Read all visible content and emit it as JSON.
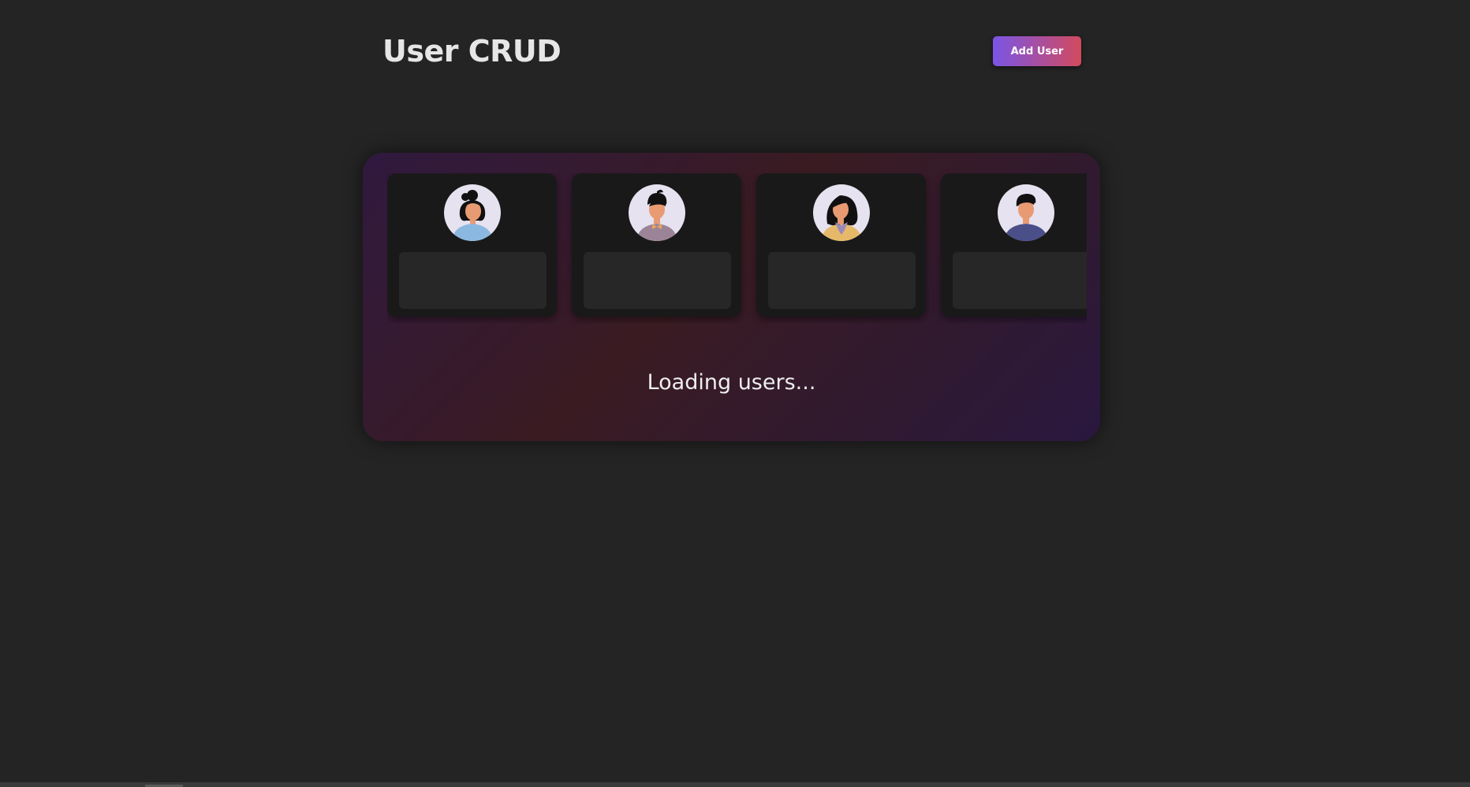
{
  "header": {
    "title": "User CRUD",
    "add_button_label": "Add User"
  },
  "users_panel": {
    "loading_text": "Loading users...",
    "cards": [
      {
        "avatar_icon": "woman-bun-avatar-icon",
        "shirt_color": "#8bb8e0"
      },
      {
        "avatar_icon": "man-bowtie-avatar-icon",
        "shirt_color": "#9b8498"
      },
      {
        "avatar_icon": "woman-scarf-avatar-icon",
        "shirt_color": "#e6b96a"
      },
      {
        "avatar_icon": "man-avatar-icon",
        "shirt_color": "#4a4f8a"
      }
    ]
  },
  "colors": {
    "background": "#242424",
    "button_gradient_start": "#7a55e6",
    "button_gradient_end": "#d24a5e"
  }
}
